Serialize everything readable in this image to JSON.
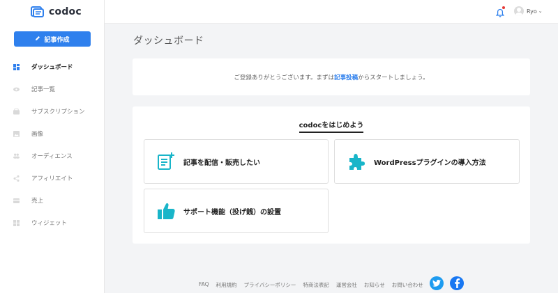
{
  "brand": {
    "name": "codoc",
    "color": "#2f80ed"
  },
  "sidebar": {
    "create_button": "記事作成",
    "items": [
      {
        "label": "ダッシュボード",
        "icon": "dashboard-icon",
        "active": true
      },
      {
        "label": "記事一覧",
        "icon": "eye-icon"
      },
      {
        "label": "サブスクリプション",
        "icon": "subscription-icon"
      },
      {
        "label": "画像",
        "icon": "image-icon"
      },
      {
        "label": "オーディエンス",
        "icon": "audience-icon"
      },
      {
        "label": "アフィリエイト",
        "icon": "share-icon"
      },
      {
        "label": "売上",
        "icon": "sales-icon"
      },
      {
        "label": "ウィジェット",
        "icon": "widget-icon"
      }
    ]
  },
  "topbar": {
    "user_name": "Ryo",
    "caret": "⌄"
  },
  "main": {
    "page_title": "ダッシュボード",
    "notice": {
      "before": "ご登録ありがとうございます。まずは",
      "link": "記事投稿",
      "after": "からスタートしましょう。"
    },
    "start": {
      "title": "codocをはじめよう",
      "cards": [
        {
          "label": "記事を配信・販売したい",
          "icon": "article-add-icon"
        },
        {
          "label": "WordPressプラグインの導入方法",
          "icon": "puzzle-icon"
        },
        {
          "label": "サポート機能（投げ銭）の設置",
          "icon": "thumbs-up-icon"
        }
      ]
    }
  },
  "footer": {
    "links": [
      "FAQ",
      "利用規約",
      "プライバシーポリシー",
      "特商法表記",
      "運営会社",
      "お知らせ",
      "お問い合わせ"
    ]
  },
  "colors": {
    "accent": "#2f80ed",
    "teal": "#19b5c9",
    "twitter": "#1d9bf0",
    "facebook": "#1877f2"
  }
}
